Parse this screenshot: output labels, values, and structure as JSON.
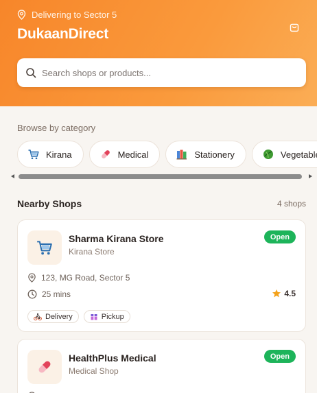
{
  "header": {
    "location_text": "Delivering to Sector 5",
    "brand": "DukaanDirect",
    "search_placeholder": "Search shops or products..."
  },
  "categories": {
    "label": "Browse by category",
    "items": [
      {
        "label": "Kirana",
        "icon": "cart-icon"
      },
      {
        "label": "Medical",
        "icon": "pill-icon"
      },
      {
        "label": "Stationery",
        "icon": "books-icon"
      },
      {
        "label": "Vegetables",
        "icon": "leafy-vegetable-icon"
      }
    ]
  },
  "nearby": {
    "title": "Nearby Shops",
    "count": "4 shops",
    "shops": [
      {
        "name": "Sharma Kirana Store",
        "type": "Kirana Store",
        "status": "Open",
        "address": "123, MG Road, Sector 5",
        "time": "25 mins",
        "rating": "4.5",
        "tags": [
          {
            "label": "Delivery",
            "icon": "bicycle-icon"
          },
          {
            "label": "Pickup",
            "icon": "package-icon"
          }
        ]
      },
      {
        "name": "HealthPlus Medical",
        "type": "Medical Shop",
        "status": "Open"
      }
    ]
  },
  "colors": {
    "header_start": "#f7862a",
    "header_end": "#fbad55",
    "open_badge": "#1db45a",
    "star": "#f4a21b"
  }
}
